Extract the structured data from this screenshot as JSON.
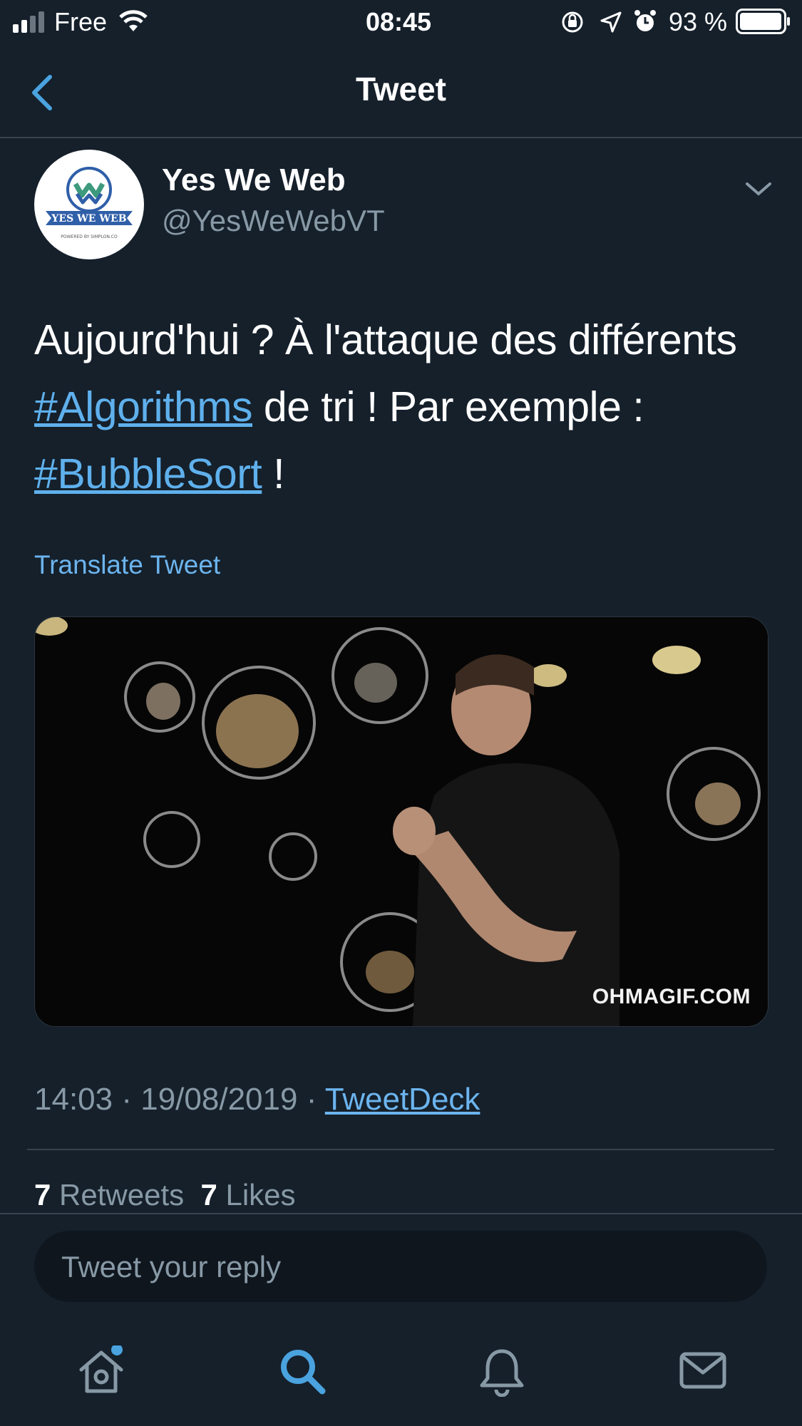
{
  "status_bar": {
    "carrier": "Free",
    "time": "08:45",
    "battery": "93 %"
  },
  "nav": {
    "title": "Tweet"
  },
  "tweet": {
    "author_name": "Yes We Web",
    "author_handle": "@YesWeWebVT",
    "avatar_logo_text": "YES WE WEB",
    "avatar_logo_subtext": "POWERED BY SIMPLON.CO",
    "text_part1": "Aujourd'hui ? À l'attaque des différents ",
    "hashtag1": "#Algorithms",
    "text_part2": " de tri ! Par exemple : ",
    "hashtag2": "#BubbleSort",
    "text_part3": " !",
    "translate_label": "Translate Tweet",
    "media_watermark": "OHMAGIF.COM",
    "time": "14:03",
    "date": "19/08/2019",
    "separator": "·",
    "source": "TweetDeck",
    "retweets_count": "7",
    "retweets_label": "Retweets",
    "likes_count": "7",
    "likes_label": "Likes"
  },
  "reply": {
    "placeholder": "Tweet your reply"
  },
  "tabbar": {
    "items": [
      "home-icon",
      "search-icon",
      "bell-icon",
      "mail-icon"
    ],
    "active": "search-icon",
    "accent": "#4aa3df"
  }
}
